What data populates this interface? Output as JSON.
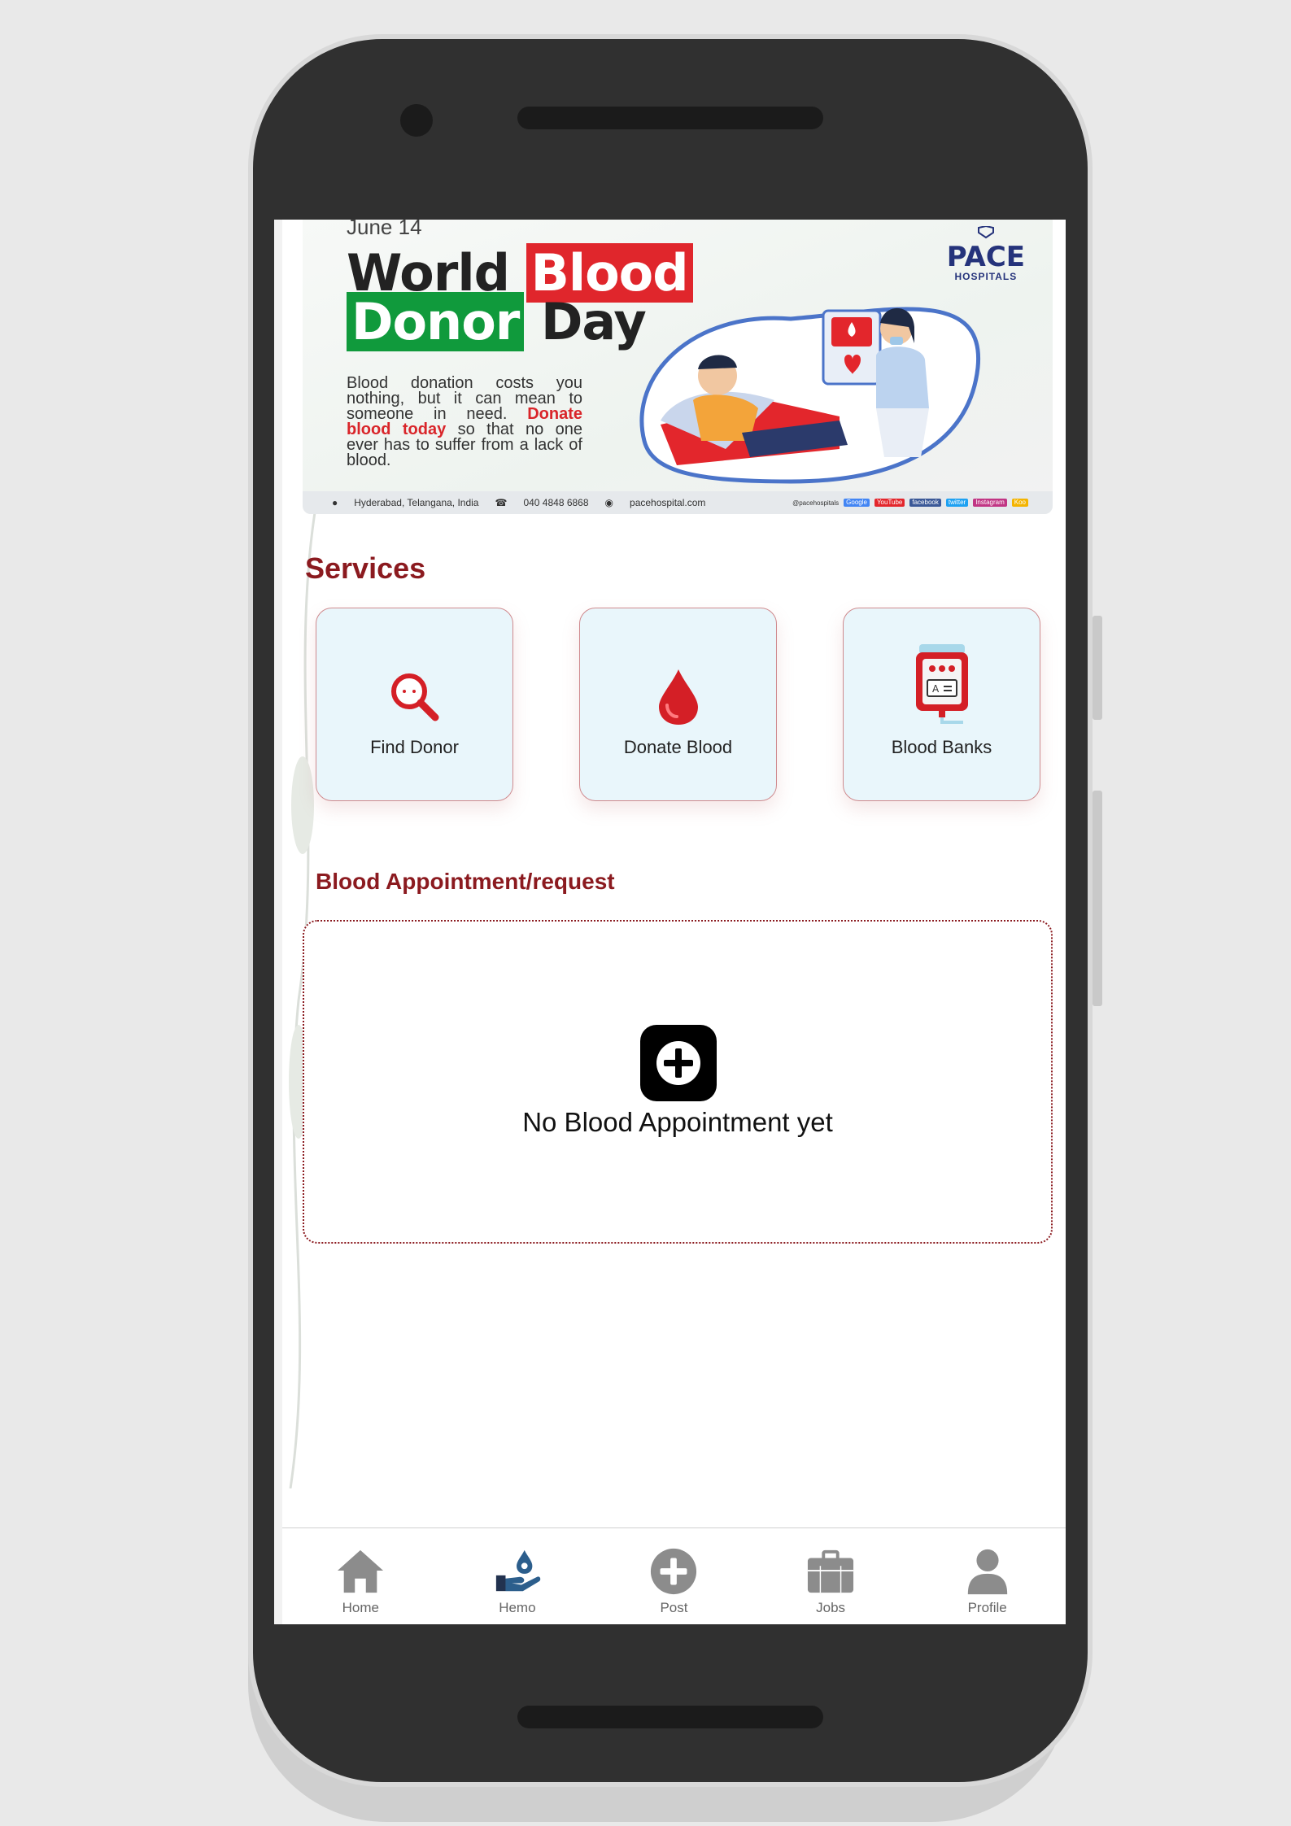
{
  "banner": {
    "date": "June 14",
    "title_word1": "World",
    "title_word2": "Blood",
    "title_word3": "Donor",
    "title_word4": "Day",
    "text_part1": "Blood donation costs you nothing, but it can mean to someone in need.",
    "text_highlight": "Donate blood today",
    "text_part2": "so that no one ever has to suffer from a lack of blood.",
    "logo_name": "PACE",
    "logo_sub": "HOSPITALS",
    "footer_location": "Hyderabad, Telangana, India",
    "footer_phone": "040 4848 6868",
    "footer_web": "pacehospital.com",
    "footer_social_handle": "@pacehospitals",
    "footer_social_google": "Google",
    "footer_social_youtube": "YouTube",
    "footer_social_facebook": "facebook",
    "footer_social_twitter": "twitter",
    "footer_social_instagram": "Instagram",
    "footer_social_koo": "Koo"
  },
  "services": {
    "title": "Services",
    "items": [
      {
        "label": "Find Donor",
        "icon": "search-icon"
      },
      {
        "label": "Donate Blood",
        "icon": "blood-drop-icon"
      },
      {
        "label": "Blood Banks",
        "icon": "blood-bag-icon"
      }
    ]
  },
  "appointment": {
    "title": "Blood Appointment/request",
    "empty_text": "No Blood Appointment yet"
  },
  "nav": {
    "items": [
      {
        "label": "Home",
        "icon": "home-icon"
      },
      {
        "label": "Hemo",
        "icon": "hemo-hand-drop-icon"
      },
      {
        "label": "Post",
        "icon": "plus-circle-icon"
      },
      {
        "label": "Jobs",
        "icon": "briefcase-icon"
      },
      {
        "label": "Profile",
        "icon": "person-icon"
      }
    ]
  },
  "colors": {
    "accent": "#8b1a1f",
    "card_bg": "#e9f6fb",
    "blood_red": "#d41f26",
    "banner_green": "#109a3c"
  }
}
